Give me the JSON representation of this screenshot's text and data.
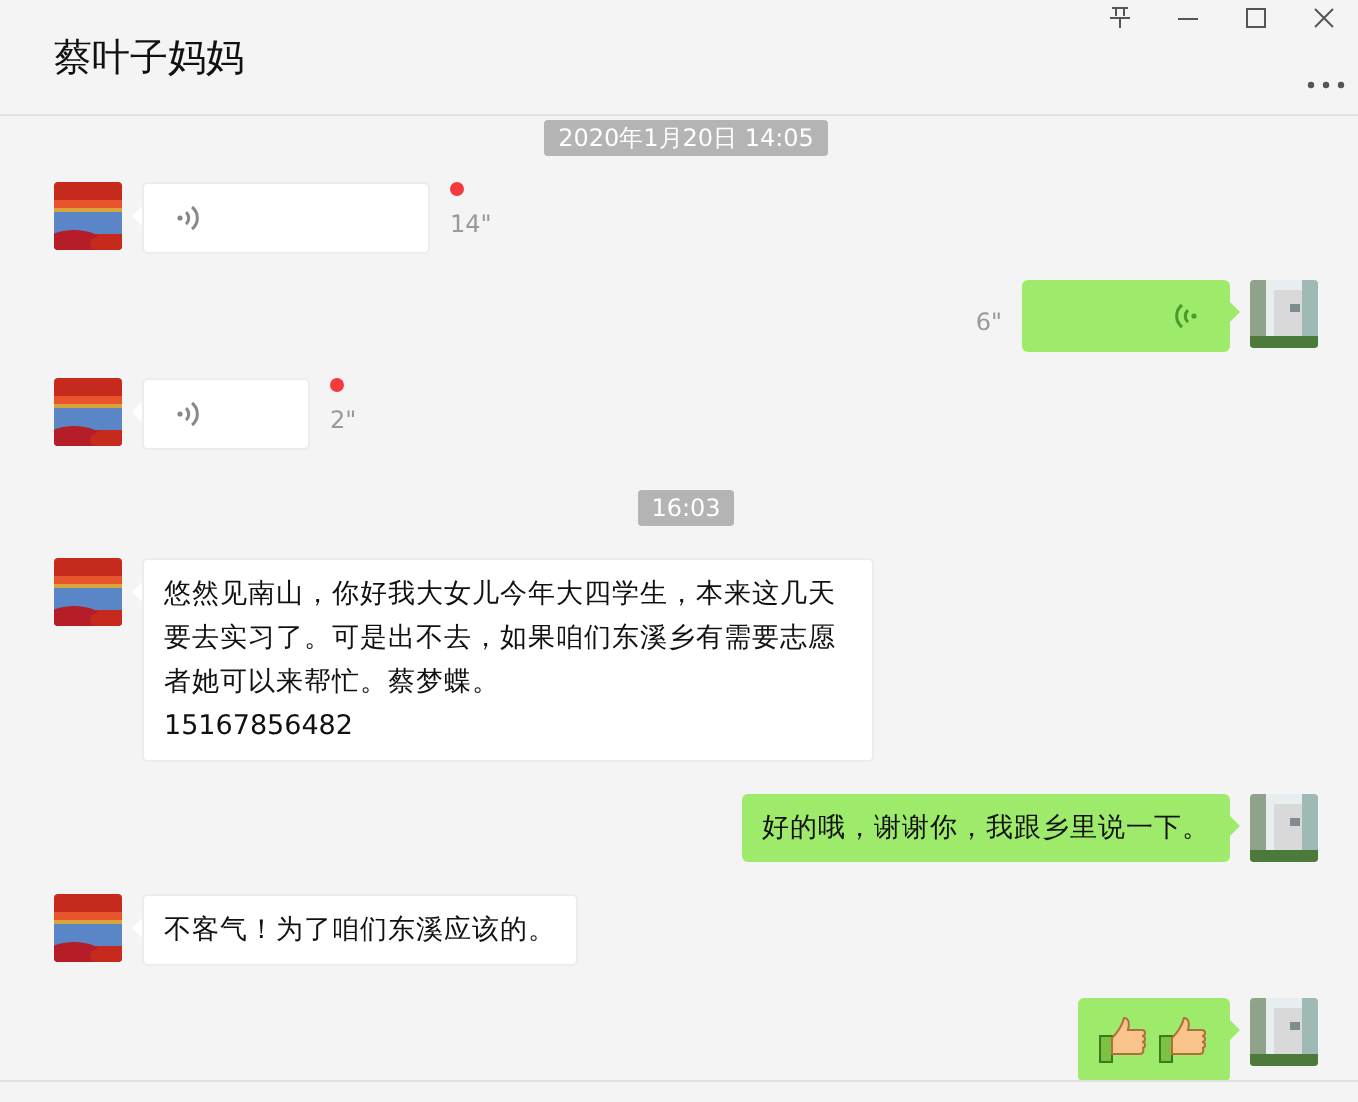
{
  "window": {
    "title": "蔡叶子妈妈",
    "controls": [
      {
        "kind": "pin"
      },
      {
        "kind": "minimize"
      },
      {
        "kind": "maximize"
      },
      {
        "kind": "close"
      }
    ]
  },
  "messages": [
    {
      "kind": "time",
      "text": "2020年1月20日 14:05"
    },
    {
      "kind": "voice",
      "outgoing": false,
      "duration": "14\"",
      "unread": true
    },
    {
      "kind": "voice",
      "outgoing": true,
      "duration": "6\"",
      "unread": false
    },
    {
      "kind": "voice",
      "outgoing": false,
      "duration": "2\"",
      "unread": true
    },
    {
      "kind": "time",
      "text": "16:03"
    },
    {
      "kind": "text",
      "outgoing": false,
      "lines": [
        "悠然见南山，你好我大女儿今年大四学生，本来这几天要去实习了。可是出不去，如果咱们东溪乡有需要志愿者她可以来帮忙。蔡梦蝶。",
        "15167856482"
      ]
    },
    {
      "kind": "text",
      "outgoing": true,
      "lines": [
        "好的哦，谢谢你，我跟乡里说一下。"
      ]
    },
    {
      "kind": "text",
      "outgoing": false,
      "lines": [
        "不客气！为了咱们东溪应该的。"
      ]
    },
    {
      "kind": "emoji",
      "outgoing": true,
      "icons": [
        {
          "kind": "thumbs-up"
        },
        {
          "kind": "thumbs-up"
        }
      ]
    }
  ]
}
